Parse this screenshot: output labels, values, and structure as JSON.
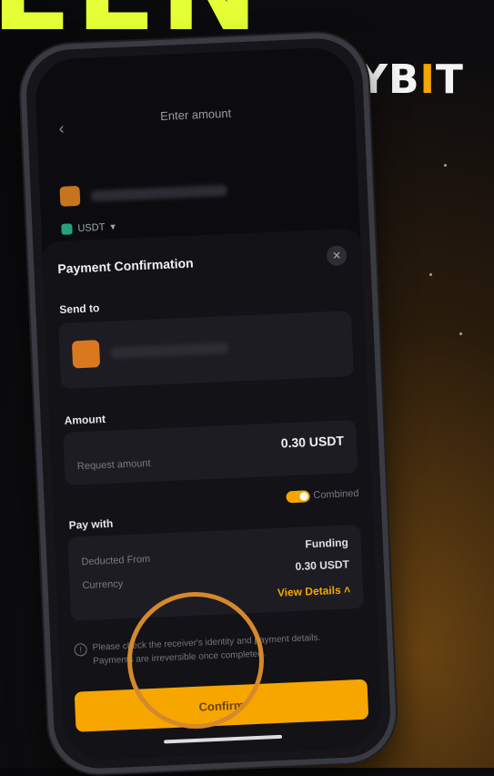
{
  "headline": "EEN",
  "brand": {
    "prefix": "BYB",
    "bar": "I",
    "suffix": "T"
  },
  "screen": {
    "title": "Enter amount",
    "currency": "USDT",
    "sheet": {
      "title": "Payment Confirmation",
      "send_to_label": "Send to",
      "amount_label": "Amount",
      "amount_value": "0.30 USDT",
      "request_label": "Request amount",
      "pay_with_label": "Pay with",
      "combined_label": "Combined",
      "deducted_label": "Deducted From",
      "funding_value": "Funding",
      "currency_label": "Currency",
      "deducted_amount": "0.30 USDT",
      "view_details": "View Details",
      "warning": "Please check the receiver's identity and payment details. Payments are irreversible once completed.",
      "confirm_label": "Confirm"
    }
  },
  "colors": {
    "accent": "#f7a600",
    "headline": "#e4ff35"
  }
}
